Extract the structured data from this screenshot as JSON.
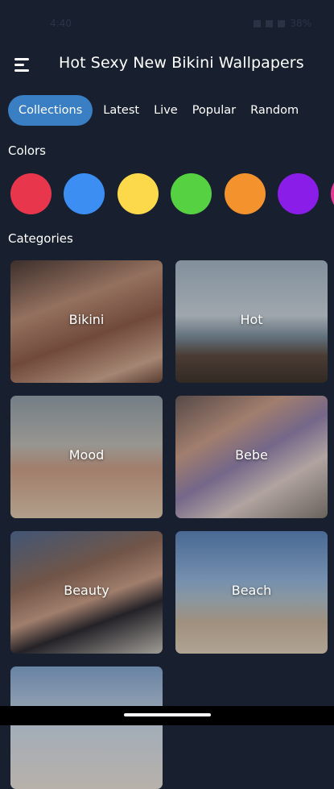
{
  "status_bar": {
    "time": "4:40",
    "battery": "38%"
  },
  "header": {
    "title": "Hot Sexy New Bikini Wallpapers",
    "menu_icon": "hamburger-menu-icon"
  },
  "tabs": [
    {
      "label": "Collections",
      "active": true
    },
    {
      "label": "Latest",
      "active": false
    },
    {
      "label": "Live",
      "active": false
    },
    {
      "label": "Popular",
      "active": false
    },
    {
      "label": "Random",
      "active": false
    }
  ],
  "colors_section": {
    "title": "Colors",
    "swatches": [
      {
        "name": "red",
        "hex": "#e8364d"
      },
      {
        "name": "blue",
        "hex": "#3d8ef2"
      },
      {
        "name": "yellow",
        "hex": "#fcd94a"
      },
      {
        "name": "green",
        "hex": "#56d142"
      },
      {
        "name": "orange",
        "hex": "#f4922d"
      },
      {
        "name": "purple",
        "hex": "#8a1ee8"
      },
      {
        "name": "pink",
        "hex": "#e23b93"
      }
    ]
  },
  "categories_section": {
    "title": "Categories",
    "items": [
      {
        "label": "Bikini"
      },
      {
        "label": "Hot"
      },
      {
        "label": "Mood"
      },
      {
        "label": "Bebe"
      },
      {
        "label": "Beauty"
      },
      {
        "label": "Beach"
      },
      {
        "label": ""
      }
    ]
  }
}
